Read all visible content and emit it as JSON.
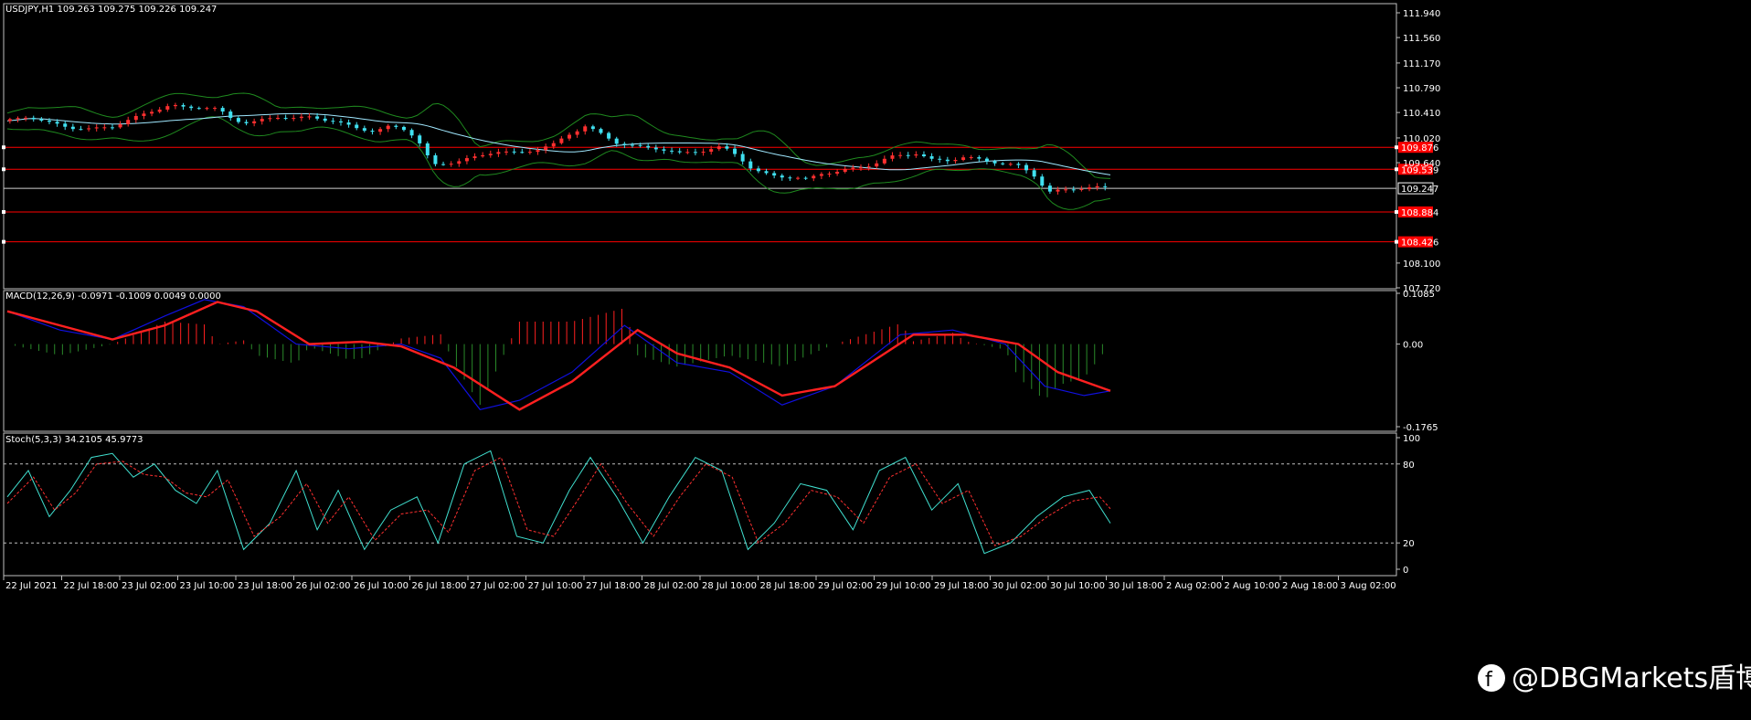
{
  "chart_data": [
    {
      "type": "candlestick",
      "title": "USDJPY,H1  109.263 109.275 109.226 109.247",
      "symbol": "USDJPY",
      "timeframe": "H1",
      "ohlc_last": {
        "open": 109.263,
        "high": 109.275,
        "low": 109.226,
        "close": 109.247
      },
      "current_price_label": "109.247",
      "ylim": [
        107.72,
        111.94
      ],
      "y_ticks": [
        "111.940",
        "111.560",
        "111.170",
        "110.790",
        "110.410",
        "110.020",
        "109.640",
        "108.100",
        "107.720"
      ],
      "horizontal_levels": [
        {
          "value": 109.876,
          "label": "109.876",
          "color": "#ff0000"
        },
        {
          "value": 109.539,
          "label": "109.539",
          "color": "#ff0000"
        },
        {
          "value": 108.884,
          "label": "108.884",
          "color": "#ff0000"
        },
        {
          "value": 108.426,
          "label": "108.426",
          "color": "#ff0000"
        }
      ],
      "bull_color": "#ff3030",
      "bear_color": "#40e0f0",
      "indicators": [
        "Bollinger Bands (green)",
        "Moving Average (light cyan)"
      ],
      "close_path": [
        [
          0,
          110.28
        ],
        [
          8,
          110.35
        ],
        [
          16,
          110.25
        ],
        [
          24,
          110.18
        ],
        [
          32,
          110.15
        ],
        [
          40,
          110.2
        ],
        [
          48,
          110.32
        ],
        [
          56,
          110.45
        ],
        [
          62,
          110.52
        ],
        [
          68,
          110.48
        ],
        [
          74,
          110.5
        ],
        [
          80,
          110.46
        ],
        [
          86,
          110.3
        ],
        [
          92,
          110.25
        ],
        [
          98,
          110.3
        ],
        [
          104,
          110.35
        ],
        [
          110,
          110.32
        ],
        [
          116,
          110.34
        ],
        [
          124,
          110.28
        ],
        [
          132,
          110.18
        ],
        [
          140,
          110.12
        ],
        [
          146,
          110.2
        ],
        [
          152,
          110.15
        ],
        [
          156,
          110.0
        ],
        [
          162,
          109.6
        ],
        [
          170,
          109.65
        ],
        [
          178,
          109.72
        ],
        [
          186,
          109.82
        ],
        [
          194,
          109.78
        ],
        [
          202,
          109.85
        ],
        [
          208,
          109.92
        ],
        [
          214,
          110.08
        ],
        [
          220,
          110.2
        ],
        [
          226,
          110.08
        ],
        [
          232,
          109.95
        ],
        [
          240,
          109.88
        ],
        [
          248,
          109.86
        ],
        [
          256,
          109.78
        ],
        [
          264,
          109.82
        ],
        [
          272,
          109.88
        ],
        [
          278,
          109.76
        ],
        [
          284,
          109.52
        ],
        [
          290,
          109.45
        ],
        [
          298,
          109.42
        ],
        [
          304,
          109.38
        ],
        [
          310,
          109.48
        ],
        [
          316,
          109.5
        ],
        [
          322,
          109.55
        ],
        [
          330,
          109.62
        ],
        [
          338,
          109.75
        ],
        [
          346,
          109.78
        ],
        [
          352,
          109.68
        ],
        [
          358,
          109.68
        ],
        [
          364,
          109.72
        ],
        [
          372,
          109.68
        ],
        [
          380,
          109.62
        ],
        [
          386,
          109.58
        ],
        [
          392,
          109.42
        ],
        [
          396,
          109.18
        ],
        [
          402,
          109.22
        ],
        [
          408,
          109.25
        ],
        [
          414,
          109.26
        ],
        [
          420,
          109.25
        ]
      ]
    },
    {
      "type": "line",
      "title": "MACD(12,26,9) -0.0971 -0.1009 0.0049 0.0000",
      "ylim": [
        -0.1765,
        0.1085
      ],
      "y_ticks": [
        "0.1085",
        "0.00",
        "-0.1765"
      ],
      "series": [
        {
          "name": "MACD",
          "color": "#1010e0",
          "points": [
            [
              0,
              0.07
            ],
            [
              20,
              0.03
            ],
            [
              40,
              0.01
            ],
            [
              60,
              0.06
            ],
            [
              75,
              0.095
            ],
            [
              90,
              0.08
            ],
            [
              110,
              0.0
            ],
            [
              130,
              -0.01
            ],
            [
              150,
              0.0
            ],
            [
              165,
              -0.03
            ],
            [
              180,
              -0.14
            ],
            [
              195,
              -0.12
            ],
            [
              215,
              -0.06
            ],
            [
              235,
              0.04
            ],
            [
              255,
              -0.04
            ],
            [
              275,
              -0.06
            ],
            [
              295,
              -0.13
            ],
            [
              315,
              -0.09
            ],
            [
              340,
              0.02
            ],
            [
              360,
              0.03
            ],
            [
              380,
              0.0
            ],
            [
              395,
              -0.09
            ],
            [
              410,
              -0.11
            ],
            [
              420,
              -0.1
            ]
          ]
        },
        {
          "name": "Signal",
          "color": "#ff2020",
          "points": [
            [
              0,
              0.07
            ],
            [
              20,
              0.04
            ],
            [
              40,
              0.01
            ],
            [
              60,
              0.04
            ],
            [
              80,
              0.09
            ],
            [
              95,
              0.07
            ],
            [
              115,
              0.0
            ],
            [
              135,
              0.005
            ],
            [
              150,
              -0.005
            ],
            [
              170,
              -0.05
            ],
            [
              195,
              -0.14
            ],
            [
              215,
              -0.08
            ],
            [
              240,
              0.03
            ],
            [
              255,
              -0.02
            ],
            [
              275,
              -0.05
            ],
            [
              295,
              -0.11
            ],
            [
              315,
              -0.09
            ],
            [
              345,
              0.02
            ],
            [
              365,
              0.02
            ],
            [
              385,
              0.0
            ],
            [
              400,
              -0.06
            ],
            [
              420,
              -0.1
            ]
          ]
        }
      ],
      "histogram_colors": {
        "positive": "#ff2020",
        "negative": "#2a8a2a"
      }
    },
    {
      "type": "line",
      "title": "Stoch(5,3,3) 34.2105 45.9773",
      "ylim": [
        0,
        100
      ],
      "y_ticks": [
        "100",
        "80",
        "20",
        "0"
      ],
      "levels": [
        80,
        20
      ],
      "series": [
        {
          "name": "%K",
          "color": "#40e0d0",
          "points": [
            [
              0,
              55
            ],
            [
              8,
              75
            ],
            [
              16,
              40
            ],
            [
              24,
              60
            ],
            [
              32,
              85
            ],
            [
              40,
              88
            ],
            [
              48,
              70
            ],
            [
              56,
              80
            ],
            [
              64,
              60
            ],
            [
              72,
              50
            ],
            [
              80,
              75
            ],
            [
              90,
              15
            ],
            [
              100,
              35
            ],
            [
              110,
              75
            ],
            [
              118,
              30
            ],
            [
              126,
              60
            ],
            [
              136,
              15
            ],
            [
              146,
              45
            ],
            [
              156,
              55
            ],
            [
              164,
              20
            ],
            [
              174,
              80
            ],
            [
              184,
              90
            ],
            [
              194,
              25
            ],
            [
              204,
              20
            ],
            [
              214,
              60
            ],
            [
              222,
              85
            ],
            [
              232,
              55
            ],
            [
              242,
              20
            ],
            [
              252,
              55
            ],
            [
              262,
              85
            ],
            [
              272,
              75
            ],
            [
              282,
              15
            ],
            [
              292,
              35
            ],
            [
              302,
              65
            ],
            [
              312,
              60
            ],
            [
              322,
              30
            ],
            [
              332,
              75
            ],
            [
              342,
              85
            ],
            [
              352,
              45
            ],
            [
              362,
              65
            ],
            [
              372,
              12
            ],
            [
              382,
              20
            ],
            [
              392,
              40
            ],
            [
              402,
              55
            ],
            [
              412,
              60
            ],
            [
              420,
              35
            ]
          ]
        },
        {
          "name": "%D",
          "color": "#ff3030",
          "points": [
            [
              0,
              50
            ],
            [
              10,
              70
            ],
            [
              18,
              45
            ],
            [
              26,
              58
            ],
            [
              34,
              80
            ],
            [
              44,
              82
            ],
            [
              52,
              72
            ],
            [
              60,
              70
            ],
            [
              68,
              58
            ],
            [
              76,
              55
            ],
            [
              84,
              68
            ],
            [
              94,
              25
            ],
            [
              104,
              40
            ],
            [
              114,
              65
            ],
            [
              122,
              35
            ],
            [
              130,
              55
            ],
            [
              140,
              22
            ],
            [
              150,
              42
            ],
            [
              160,
              45
            ],
            [
              168,
              28
            ],
            [
              178,
              75
            ],
            [
              188,
              85
            ],
            [
              198,
              30
            ],
            [
              208,
              25
            ],
            [
              218,
              55
            ],
            [
              226,
              80
            ],
            [
              236,
              50
            ],
            [
              246,
              25
            ],
            [
              256,
              55
            ],
            [
              266,
              80
            ],
            [
              276,
              70
            ],
            [
              286,
              20
            ],
            [
              296,
              35
            ],
            [
              306,
              60
            ],
            [
              316,
              55
            ],
            [
              326,
              35
            ],
            [
              336,
              70
            ],
            [
              346,
              80
            ],
            [
              356,
              50
            ],
            [
              366,
              60
            ],
            [
              376,
              18
            ],
            [
              386,
              25
            ],
            [
              396,
              40
            ],
            [
              406,
              52
            ],
            [
              416,
              55
            ],
            [
              420,
              46
            ]
          ]
        }
      ]
    }
  ],
  "x_axis": {
    "tick_labels": [
      "22 Jul 2021",
      "22 Jul 18:00",
      "23 Jul 02:00",
      "23 Jul 10:00",
      "23 Jul 18:00",
      "26 Jul 02:00",
      "26 Jul 10:00",
      "26 Jul 18:00",
      "27 Jul 02:00",
      "27 Jul 10:00",
      "27 Jul 18:00",
      "28 Jul 02:00",
      "28 Jul 10:00",
      "28 Jul 18:00",
      "29 Jul 02:00",
      "29 Jul 10:00",
      "29 Jul 18:00",
      "30 Jul 02:00",
      "30 Jul 10:00",
      "30 Jul 18:00",
      "2 Aug 02:00",
      "2 Aug 10:00",
      "2 Aug 18:00",
      "3 Aug 02:00"
    ]
  },
  "watermark": "@DBGMarkets盾博",
  "colors": {
    "grid_border": "#c0c0c0",
    "background": "#000000",
    "text": "#ffffff"
  }
}
